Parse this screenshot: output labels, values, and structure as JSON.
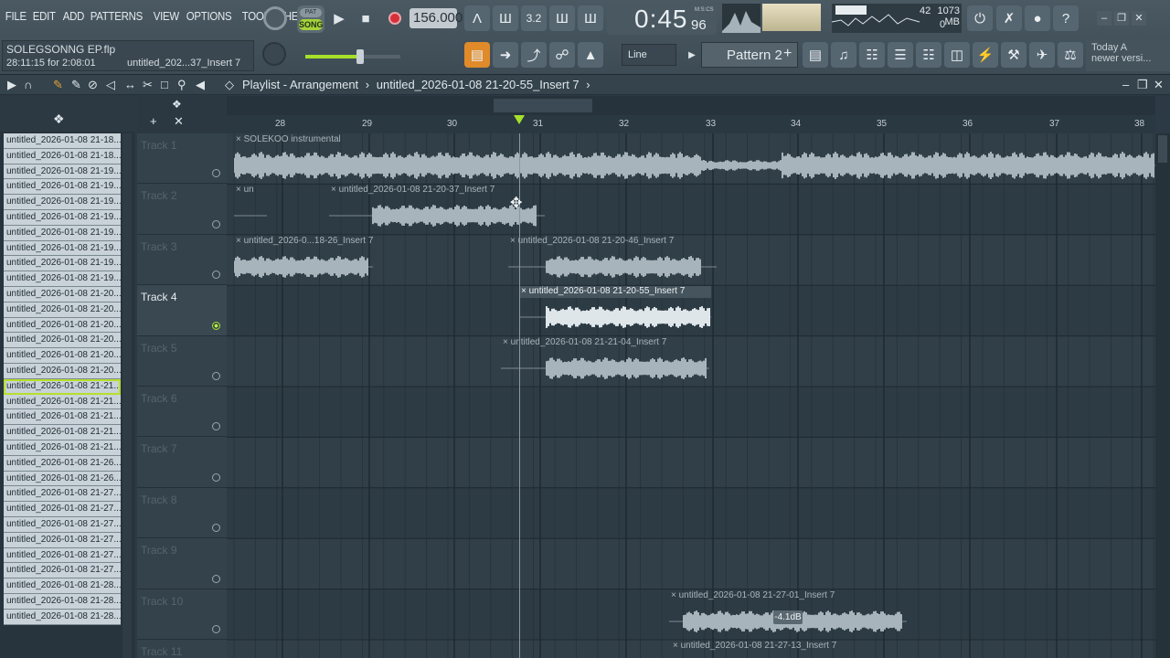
{
  "menu": [
    "FILE",
    "EDIT",
    "ADD",
    "PATTERNS",
    "VIEW",
    "OPTIONS",
    "TOOLS",
    "HELP"
  ],
  "song": {
    "filename": "SOLEGSONNG EP.flp",
    "elapsed": "28:11:15 for 2:08:01",
    "insert_hint": "untitled_202...37_Insert 7"
  },
  "transport": {
    "pat_label": "PAT",
    "song_label": "SONG",
    "tempo": "156.000",
    "time_main": "0:45",
    "time_small": "96",
    "time_label": "M:S:CS"
  },
  "perf": {
    "cpu": "42",
    "ram": "1073 MB",
    "poly": "0"
  },
  "snap": "Line",
  "pattern": "Pattern 2",
  "news": {
    "line1": "Today  A",
    "line2": "newer versi..."
  },
  "playlist": {
    "title": "Playlist - Arrangement",
    "separator": "›",
    "clip": "untitled_2026-01-08 21-20-55_Insert 7",
    "end_mark": "›"
  },
  "ruler": [
    "28",
    "29",
    "30",
    "31",
    "32",
    "33",
    "34",
    "35",
    "36",
    "37",
    "38"
  ],
  "tracks": [
    "Track 1",
    "Track 2",
    "Track 3",
    "Track 4",
    "Track 5",
    "Track 6",
    "Track 7",
    "Track 8",
    "Track 9",
    "Track 10",
    "Track 11"
  ],
  "browser_items": [
    "untitled_2026-01-08 21-18...",
    "untitled_2026-01-08 21-18...",
    "untitled_2026-01-08 21-19...",
    "untitled_2026-01-08 21-19...",
    "untitled_2026-01-08 21-19...",
    "untitled_2026-01-08 21-19...",
    "untitled_2026-01-08 21-19...",
    "untitled_2026-01-08 21-19...",
    "untitled_2026-01-08 21-19...",
    "untitled_2026-01-08 21-19...",
    "untitled_2026-01-08 21-20...",
    "untitled_2026-01-08 21-20...",
    "untitled_2026-01-08 21-20...",
    "untitled_2026-01-08 21-20...",
    "untitled_2026-01-08 21-20...",
    "untitled_2026-01-08 21-20...",
    "untitled_2026-01-08 21-21...",
    "untitled_2026-01-08 21-21...",
    "untitled_2026-01-08 21-21...",
    "untitled_2026-01-08 21-21...",
    "untitled_2026-01-08 21-21...",
    "untitled_2026-01-08 21-26...",
    "untitled_2026-01-08 21-26...",
    "untitled_2026-01-08 21-27...",
    "untitled_2026-01-08 21-27...",
    "untitled_2026-01-08 21-27...",
    "untitled_2026-01-08 21-27...",
    "untitled_2026-01-08 21-27...",
    "untitled_2026-01-08 21-27...",
    "untitled_2026-01-08 21-28...",
    "untitled_2026-01-08 21-28...",
    "untitled_2026-01-08 21-28..."
  ],
  "clips": [
    {
      "label": "SOLEKOO instrumental"
    },
    {
      "label": "un"
    },
    {
      "label": "untitled_2026-01-08 21-20-37_Insert 7"
    },
    {
      "label": "untitled_2026-0...18-26_Insert 7"
    },
    {
      "label": "untitled_2026-01-08 21-20-46_Insert 7"
    },
    {
      "label": "untitled_2026-01-08 21-20-55_Insert 7"
    },
    {
      "label": "untitled_2026-01-08 21-21-04_Insert 7"
    },
    {
      "label": "untitled_2026-01-08 21-27-01_Insert 7"
    },
    {
      "label": "untitled_2026-01-08 21-27-13_Insert 7"
    }
  ],
  "volume_hint": "-4.1dB",
  "colors": {
    "accent": "#a6e02a",
    "clip_wave": "#a8b4bb",
    "bg": "#2f3d46"
  }
}
